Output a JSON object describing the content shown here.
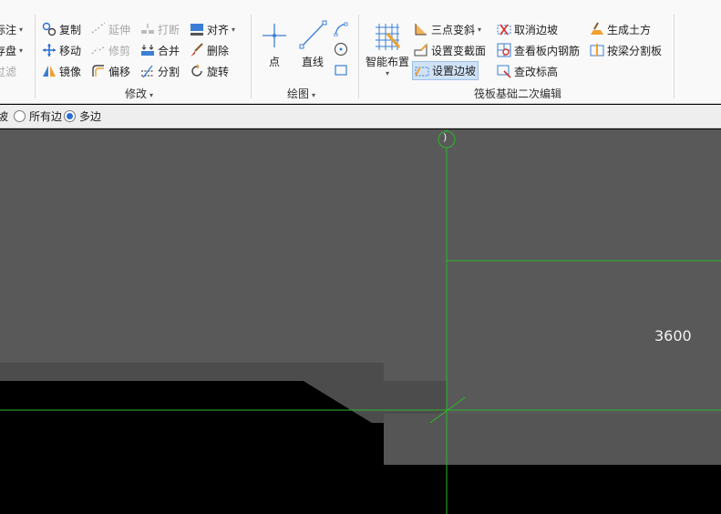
{
  "ribbon": {
    "col0": [
      {
        "label": "标注",
        "dropdown": true
      },
      {
        "label": "存盘",
        "dropdown": true
      },
      {
        "label": "过滤",
        "disabled": true
      }
    ],
    "modify": {
      "row1": [
        {
          "label": "复制",
          "icon": "copy-icon"
        },
        {
          "label": "延伸",
          "icon": "extend-icon",
          "disabled": true
        },
        {
          "label": "打断",
          "icon": "break-icon",
          "disabled": true
        },
        {
          "label": "对齐",
          "icon": "align-icon",
          "dropdown": true
        }
      ],
      "row2": [
        {
          "label": "移动",
          "icon": "move-icon"
        },
        {
          "label": "修剪",
          "icon": "trim-icon",
          "disabled": true
        },
        {
          "label": "合并",
          "icon": "merge-icon"
        },
        {
          "label": "删除",
          "icon": "delete-icon"
        }
      ],
      "row3": [
        {
          "label": "镜像",
          "icon": "mirror-icon"
        },
        {
          "label": "偏移",
          "icon": "offset-icon"
        },
        {
          "label": "分割",
          "icon": "split-icon"
        },
        {
          "label": "旋转",
          "icon": "rotate-icon"
        }
      ],
      "group_label": "修改"
    },
    "draw": {
      "point_label": "点",
      "line_label": "直线",
      "group_label": "绘图"
    },
    "raft": {
      "smart_label": "智能布置",
      "col1": [
        {
          "label": "三点变斜",
          "dropdown": true
        },
        {
          "label": "设置变截面"
        },
        {
          "label": "设置边坡",
          "active": true
        }
      ],
      "col2": [
        {
          "label": "取消边坡"
        },
        {
          "label": "查看板内钢筋"
        },
        {
          "label": "查改标高"
        }
      ],
      "col3": [
        {
          "label": "生成土方"
        },
        {
          "label": "按梁分割板"
        }
      ],
      "group_label": "筏板基础二次编辑"
    }
  },
  "options": {
    "partial_label": "坡",
    "all_edges": "所有边",
    "multi_edges": "多边",
    "selected": "multi_edges"
  },
  "canvas": {
    "dimension_text": "3600",
    "marker_text": ")",
    "colors": {
      "background": "#000000",
      "slab": "#595959",
      "slab_dark": "#4a4a4a",
      "grid_line": "#2db82d"
    }
  }
}
